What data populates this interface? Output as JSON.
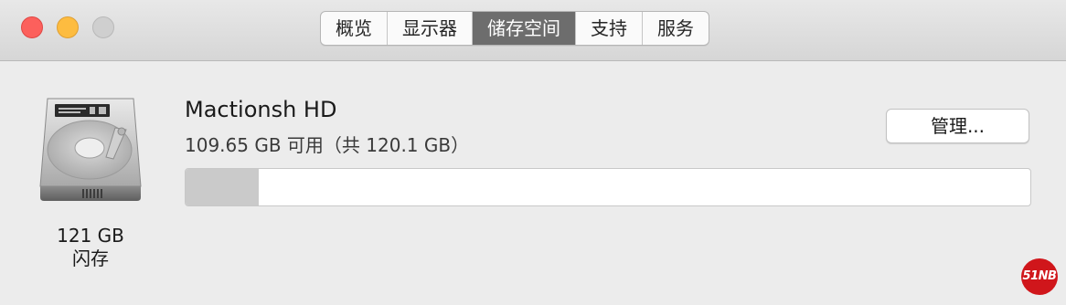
{
  "tabs": [
    {
      "label": "概览",
      "selected": false
    },
    {
      "label": "显示器",
      "selected": false
    },
    {
      "label": "储存空间",
      "selected": true
    },
    {
      "label": "支持",
      "selected": false
    },
    {
      "label": "服务",
      "selected": false
    }
  ],
  "drive": {
    "icon": "hard-drive-icon",
    "capacity_label": "121 GB",
    "type_label": "闪存",
    "name": "Mactionsh HD",
    "availability": "109.65 GB 可用（共 120.1 GB）",
    "used_fraction": 0.087
  },
  "manage_button": {
    "label": "管理..."
  },
  "watermark": {
    "text": "51NB"
  },
  "colors": {
    "close": "#fc605c",
    "minimize": "#fdbc40",
    "zoom": "#cfcfcf",
    "selected_tab": "#6d6d6d",
    "usage_fill": "#cacaca",
    "watermark": "#d0161b"
  }
}
